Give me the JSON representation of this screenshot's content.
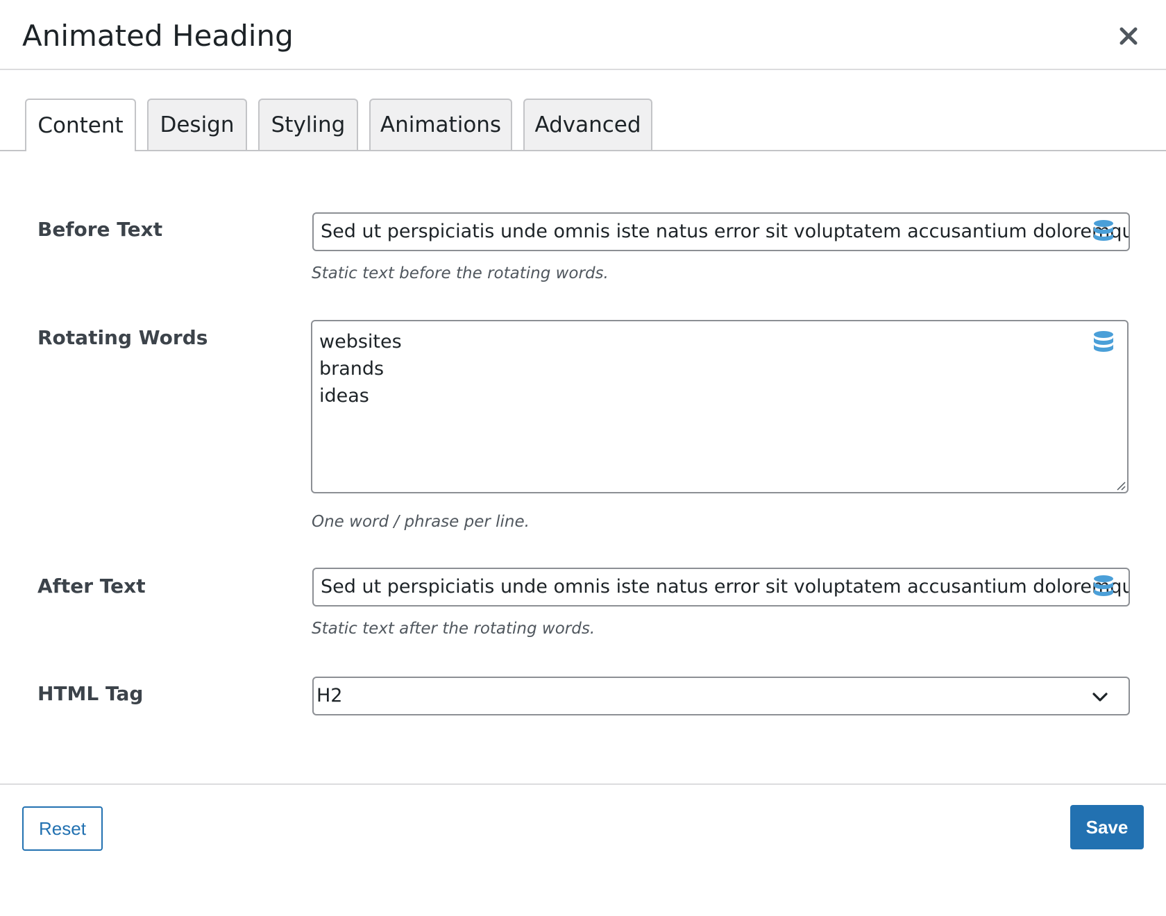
{
  "modal": {
    "title": "Animated Heading"
  },
  "tabs": [
    {
      "label": "Content",
      "active": true
    },
    {
      "label": "Design",
      "active": false
    },
    {
      "label": "Styling",
      "active": false
    },
    {
      "label": "Animations",
      "active": false
    },
    {
      "label": "Advanced",
      "active": false
    }
  ],
  "fields": {
    "before_text": {
      "label": "Before Text",
      "value": "Sed ut perspiciatis unde omnis iste natus error sit voluptatem accusantium doloremque la",
      "help": "Static text before the rotating words.",
      "icon": "database-icon"
    },
    "rotating_words": {
      "label": "Rotating Words",
      "lines": [
        "websites",
        "brands",
        "ideas"
      ],
      "help": "One word / phrase per line.",
      "icon": "database-icon"
    },
    "after_text": {
      "label": "After Text",
      "value": "Sed ut perspiciatis unde omnis iste natus error sit voluptatem accusantium doloremque la",
      "help": "Static text after the rotating words.",
      "icon": "database-icon"
    },
    "html_tag": {
      "label": "HTML Tag",
      "selected": "H2",
      "icon": "chevron-down-icon"
    }
  },
  "footer": {
    "reset_label": "Reset",
    "save_label": "Save"
  },
  "colors": {
    "accent": "#2271b1",
    "icon_blue": "#4a9fd8",
    "border": "#8c8f94",
    "tab_inactive_bg": "#f0f0f1"
  }
}
